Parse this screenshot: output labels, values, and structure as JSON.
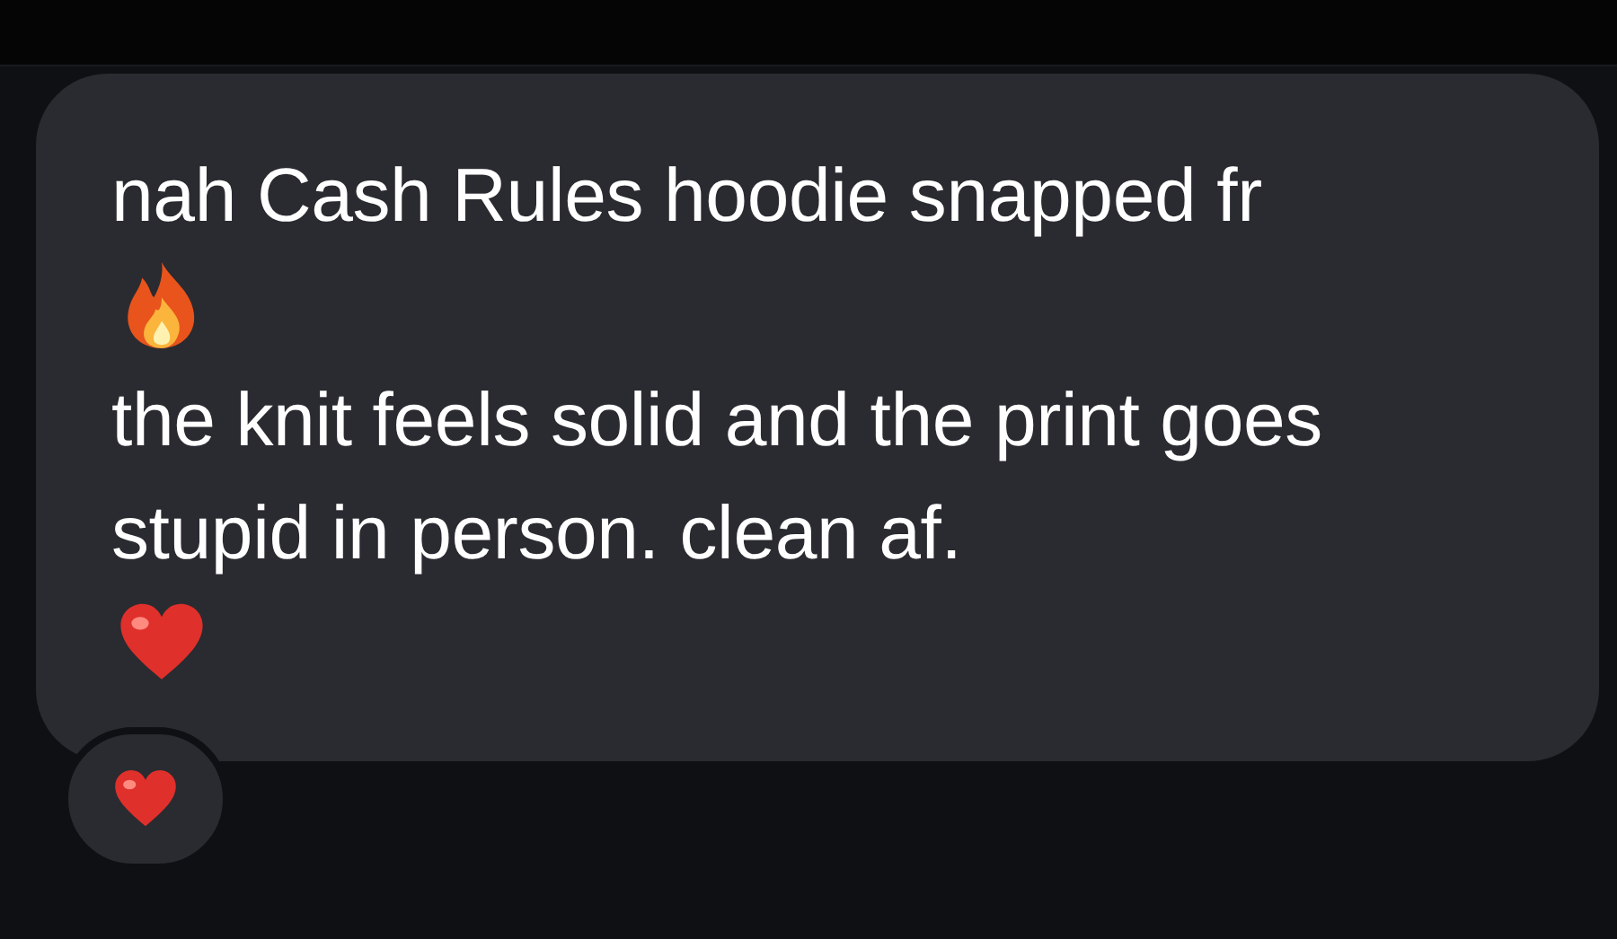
{
  "message": {
    "lines": [
      {
        "kind": "text",
        "text": "nah Cash Rules hoodie snapped fr"
      },
      {
        "kind": "fire"
      },
      {
        "kind": "text",
        "text": "the knit feels solid and the print goes stupid in person. clean af."
      },
      {
        "kind": "heart"
      }
    ]
  },
  "reaction": {
    "kind": "heart"
  }
}
